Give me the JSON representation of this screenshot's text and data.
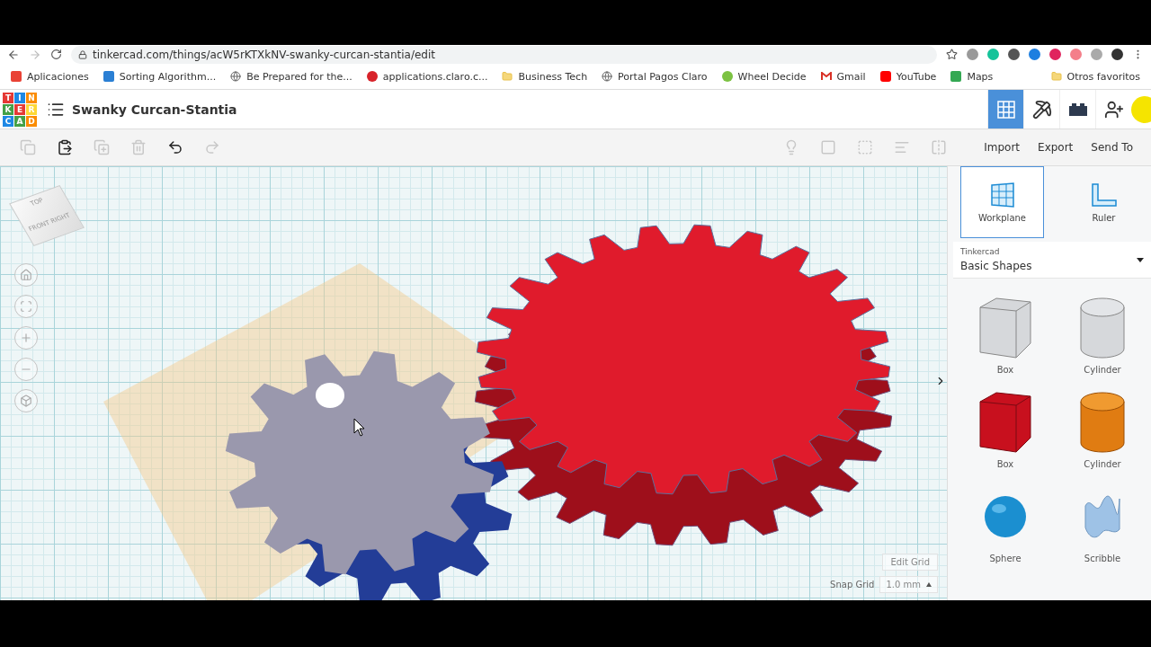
{
  "browser": {
    "url": "tinkercad.com/things/acW5rKTXkNV-swanky-curcan-stantia/edit"
  },
  "bookmarks": [
    {
      "kind": "apps",
      "label": "Aplicaciones"
    },
    {
      "kind": "blue",
      "label": "Sorting Algorithm..."
    },
    {
      "kind": "globe",
      "label": "Be Prepared for the..."
    },
    {
      "kind": "claro",
      "label": "applications.claro.c..."
    },
    {
      "kind": "folder",
      "label": "Business Tech"
    },
    {
      "kind": "globe",
      "label": "Portal Pagos Claro"
    },
    {
      "kind": "wheel",
      "label": "Wheel Decide"
    },
    {
      "kind": "gmail",
      "label": "Gmail"
    },
    {
      "kind": "youtube",
      "label": "YouTube"
    },
    {
      "kind": "maps",
      "label": "Maps"
    }
  ],
  "other_bookmarks": "Otros favoritos",
  "app": {
    "logo": [
      "T",
      "I",
      "N",
      "K",
      "E",
      "R",
      "C",
      "A",
      "D"
    ],
    "design_title": "Swanky Curcan-Stantia"
  },
  "view_modes": [
    {
      "kind": "grid",
      "selected": true
    },
    {
      "kind": "pickaxe",
      "selected": false
    },
    {
      "kind": "bricks",
      "selected": false
    }
  ],
  "edit_tools": [
    {
      "kind": "copy",
      "disabled": true
    },
    {
      "kind": "paste",
      "disabled": false
    },
    {
      "kind": "duplicate",
      "disabled": true
    },
    {
      "kind": "delete",
      "disabled": true
    },
    {
      "kind": "undo",
      "disabled": false
    },
    {
      "kind": "redo",
      "disabled": true
    }
  ],
  "shape_tools": [
    {
      "kind": "note",
      "disabled": true
    },
    {
      "kind": "group",
      "disabled": true
    },
    {
      "kind": "ungroup",
      "disabled": true
    },
    {
      "kind": "align",
      "disabled": true
    },
    {
      "kind": "mirror",
      "disabled": true
    }
  ],
  "actions": [
    "Import",
    "Export",
    "Send To"
  ],
  "view_cube": {
    "top": "TOP",
    "front": "FRONT",
    "right": "RIGHT"
  },
  "nav_controls": [
    {
      "kind": "home"
    },
    {
      "kind": "fit"
    },
    {
      "kind": "zoom-in"
    },
    {
      "kind": "zoom-out"
    },
    {
      "kind": "perspective"
    }
  ],
  "grid": {
    "edit_label": "Edit Grid",
    "snap_label": "Snap Grid",
    "snap_value": "1.0 mm"
  },
  "panel_tools": [
    {
      "kind": "workplane",
      "label": "Workplane",
      "selected": true
    },
    {
      "kind": "ruler",
      "label": "Ruler",
      "selected": false
    }
  ],
  "library": {
    "source": "Tinkercad",
    "category": "Basic Shapes"
  },
  "shapes": [
    {
      "kind": "hole-box",
      "label": "Box"
    },
    {
      "kind": "hole-cylinder",
      "label": "Cylinder"
    },
    {
      "kind": "box",
      "label": "Box"
    },
    {
      "kind": "cylinder",
      "label": "Cylinder"
    },
    {
      "kind": "sphere",
      "label": "Sphere"
    },
    {
      "kind": "scribble",
      "label": "Scribble"
    }
  ]
}
